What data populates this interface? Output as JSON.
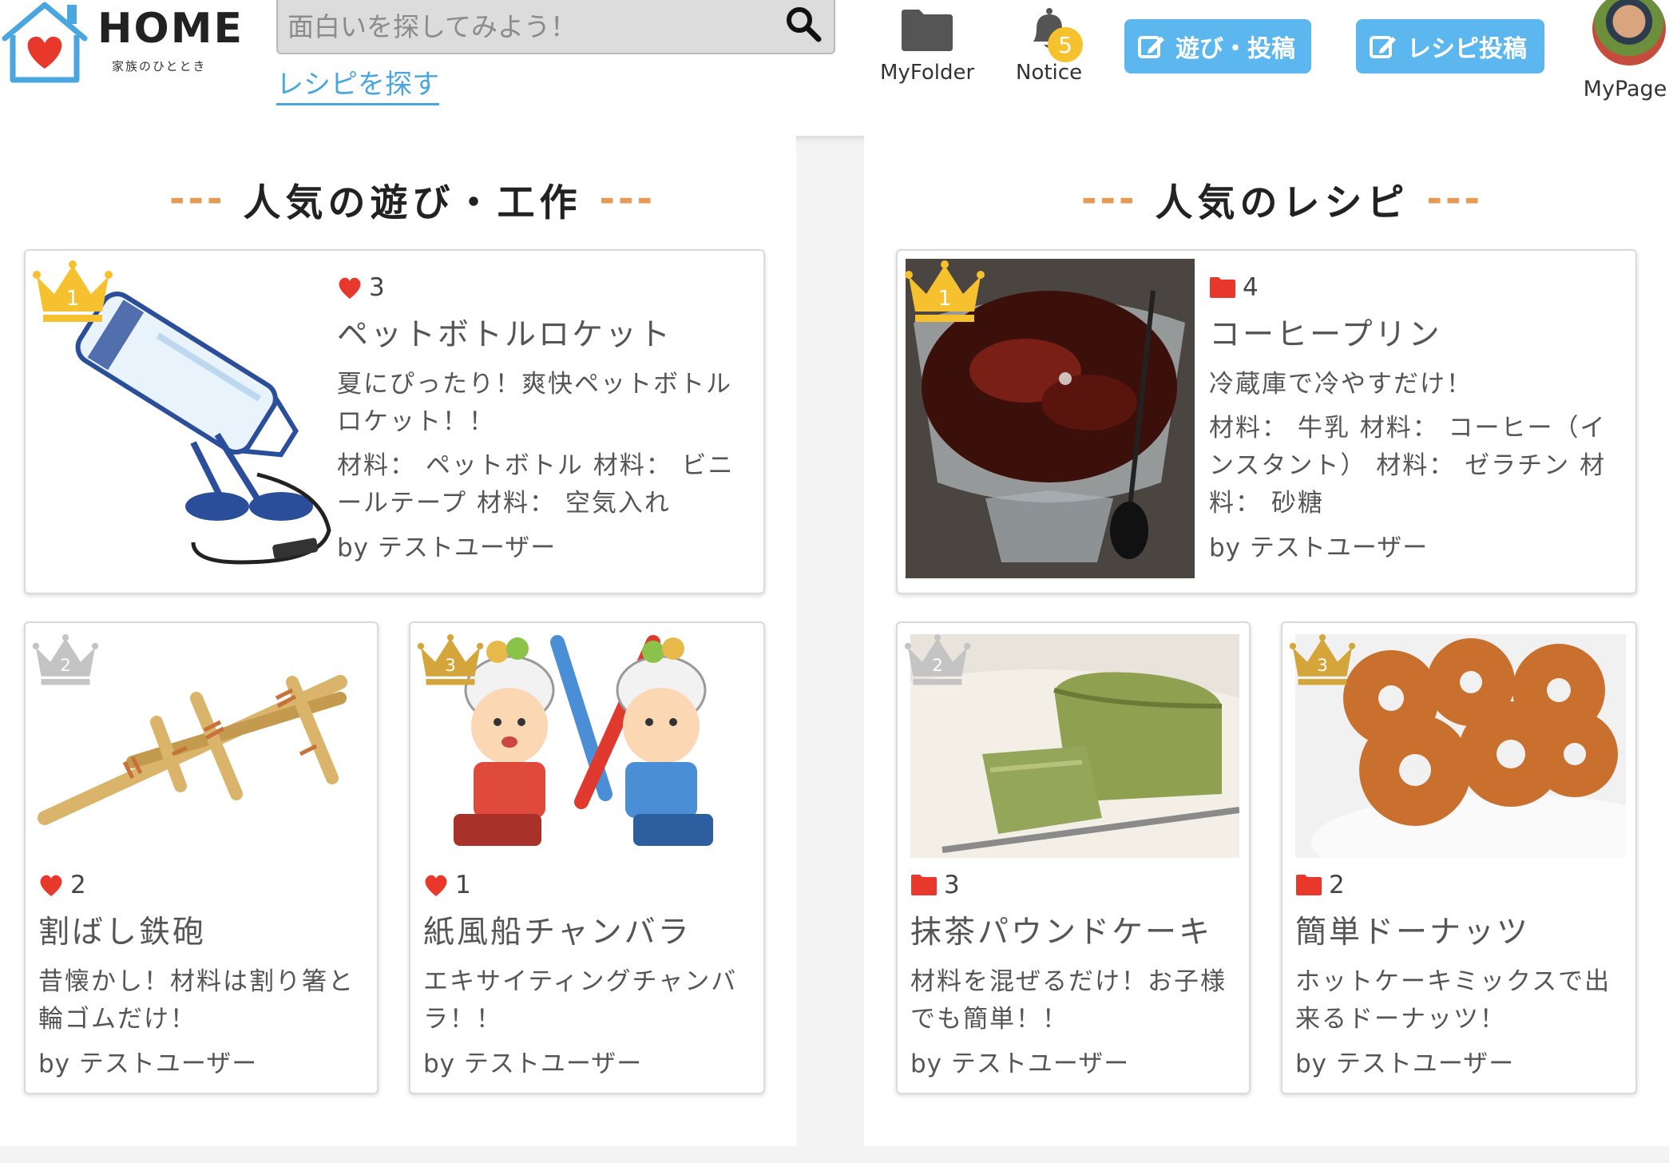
{
  "header": {
    "logo_title": "HOME",
    "logo_sub": "家族のひととき",
    "search_placeholder": "面白いを探してみよう！",
    "find_recipe": "レシピを探す",
    "myfolder": "MyFolder",
    "notice": "Notice",
    "notice_count": "5",
    "post_play": "遊び・投稿",
    "post_recipe": "レシピ投稿",
    "mypage": "MyPage"
  },
  "colors": {
    "accent": "#5bb7ee",
    "heart": "#e8382c",
    "folder": "#e8382c",
    "dash": "#e59a55",
    "gold": "#f6c12e",
    "silver": "#c4c4c4",
    "bronze": "#d4a53a"
  },
  "play": {
    "title": "人気の遊び・工作",
    "dashes": "---",
    "items": [
      {
        "rank": "1",
        "count": "3",
        "title": "ペットボトルロケット",
        "desc": "夏にぴったり！爽快ペットボトルロケット！！",
        "materials": "材料： ペットボトル 材料： ビニールテープ 材料： 空気入れ",
        "by": "by テストユーザー"
      },
      {
        "rank": "2",
        "count": "2",
        "title": "割ばし鉄砲",
        "desc": "昔懐かし！材料は割り箸と輪ゴムだけ！",
        "by": "by テストユーザー"
      },
      {
        "rank": "3",
        "count": "1",
        "title": "紙風船チャンバラ",
        "desc": "エキサイティングチャンバラ！！",
        "by": "by テストユーザー"
      }
    ]
  },
  "recipe": {
    "title": "人気のレシピ",
    "dashes": "---",
    "items": [
      {
        "rank": "1",
        "count": "4",
        "title": "コーヒープリン",
        "desc": "冷蔵庫で冷やすだけ！",
        "materials": "材料： 牛乳 材料： コーヒー（インスタント） 材料： ゼラチン 材料： 砂糖",
        "by": "by テストユーザー"
      },
      {
        "rank": "2",
        "count": "3",
        "title": "抹茶パウンドケーキ",
        "desc": "材料を混ぜるだけ！お子様でも簡単！！",
        "by": "by テストユーザー"
      },
      {
        "rank": "3",
        "count": "2",
        "title": "簡単ドーナッツ",
        "desc": "ホットケーキミックスで出来るドーナッツ！",
        "by": "by テストユーザー"
      }
    ]
  }
}
